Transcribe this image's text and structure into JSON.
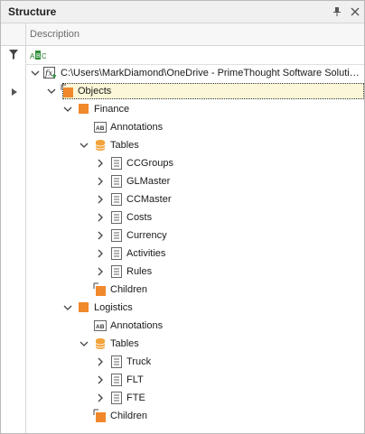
{
  "panel": {
    "title": "Structure",
    "pin_icon": "pin-icon",
    "close_icon": "close-icon"
  },
  "header": {
    "description_label": "Description",
    "filter_icon": "filter-icon",
    "abc_icon": "abc-icon"
  },
  "tree": {
    "root_path": "C:\\Users\\MarkDiamond\\OneDrive - PrimeThought Software Solutions\\...",
    "objects_label": "Objects",
    "finance": {
      "label": "Finance",
      "annotations": "Annotations",
      "tables": "Tables",
      "tables_list": [
        "CCGroups",
        "GLMaster",
        "CCMaster",
        "Costs",
        "Currency",
        "Activities",
        "Rules"
      ],
      "children": "Children"
    },
    "logistics": {
      "label": "Logistics",
      "annotations": "Annotations",
      "tables": "Tables",
      "tables_list": [
        "Truck",
        "FLT",
        "FTE"
      ],
      "children": "Children"
    }
  },
  "colors": {
    "object_orange": "#f0892b",
    "selection_bg": "#fbf7d8",
    "table_db_orange": "#f2a33a"
  }
}
